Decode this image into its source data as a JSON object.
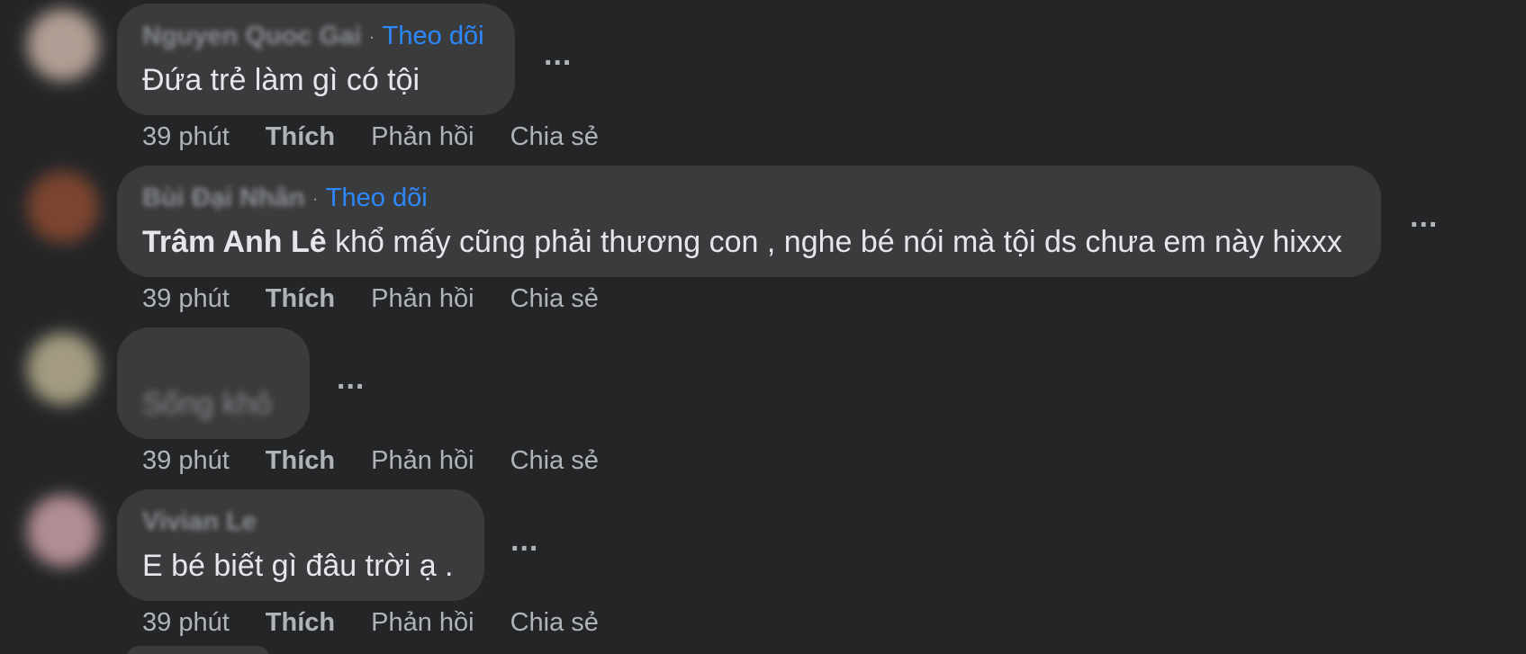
{
  "comments": [
    {
      "author": "Nguyen Quoc Gai",
      "follow_label": "Theo dõi",
      "text": "Đứa trẻ làm gì có tội",
      "mention": "",
      "time": "39 phút",
      "like": "Thích",
      "reply": "Phản hồi",
      "share": "Chia sẻ",
      "avatar_color": "#c9b3a6"
    },
    {
      "author": "Bùi Đại Nhân",
      "follow_label": "Theo dõi",
      "mention": "Trâm Anh Lê",
      "text": " khổ mấy cũng phải thương con , nghe bé nói mà tội ds chưa em này hixxx",
      "time": "39 phút",
      "like": "Thích",
      "reply": "Phản hồi",
      "share": "Chia sẻ",
      "avatar_color": "#8a4a32"
    },
    {
      "author": "",
      "follow_label": "",
      "text": "Sống khỏ",
      "mention": "",
      "time": "39 phút",
      "like": "Thích",
      "reply": "Phản hồi",
      "share": "Chia sẻ",
      "avatar_color": "#b8b090"
    },
    {
      "author": "Vivian Le",
      "follow_label": "",
      "text": "E bé biết gì đâu trời ạ .",
      "mention": "",
      "time": "39 phút",
      "like": "Thích",
      "reply": "Phản hồi",
      "share": "Chia sẻ",
      "avatar_color": "#c9a0a6"
    }
  ],
  "more_label": "..."
}
